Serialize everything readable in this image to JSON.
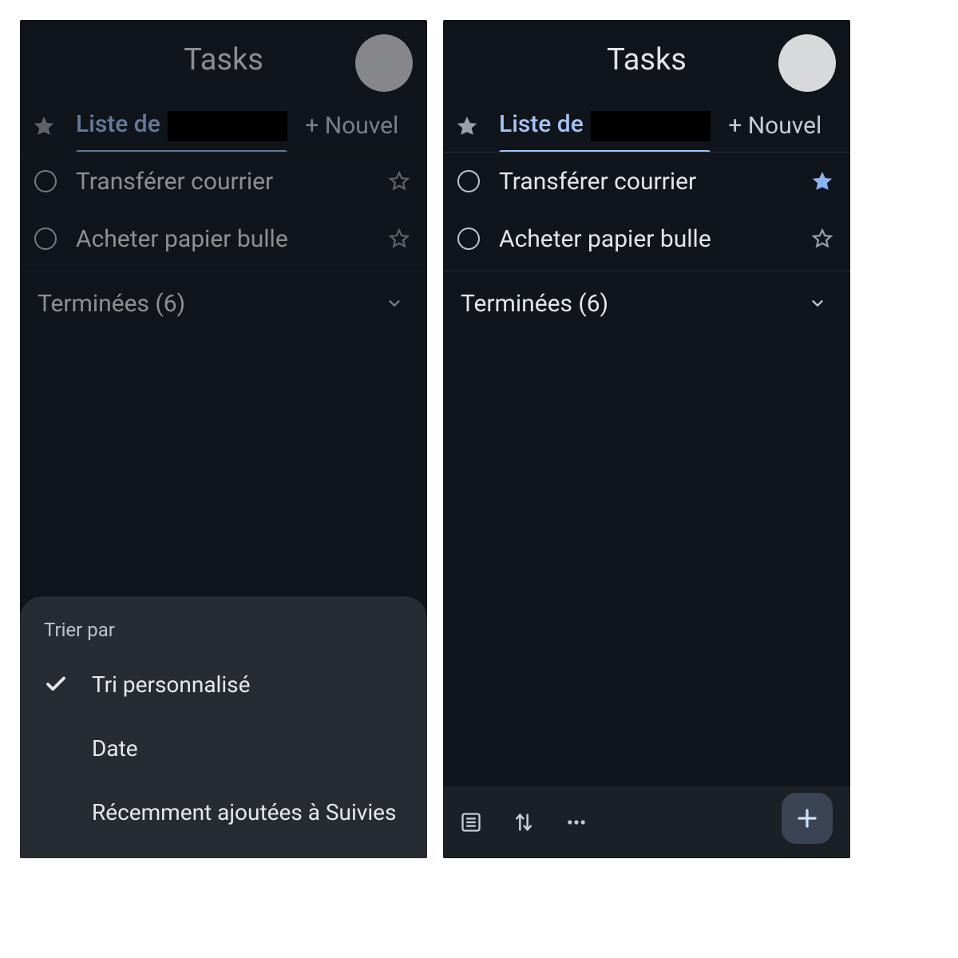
{
  "colors": {
    "accent": "#a5c3f5",
    "text": "#e4e7ea",
    "starFilled": "#8cb3f2",
    "starOutline": "#9aa0a7",
    "circleOutline": "#c0c6cd"
  },
  "left": {
    "header": {
      "title": "Tasks"
    },
    "tabs": {
      "listPrefix": "Liste de ",
      "newList": "+ Nouvel"
    },
    "tasks": [
      {
        "title": "Transférer courrier",
        "starred": false
      },
      {
        "title": "Acheter papier bulle",
        "starred": false
      }
    ],
    "completedLabel": "Terminées (6)",
    "sheet": {
      "title": "Trier par",
      "options": [
        {
          "label": "Tri personnalisé",
          "selected": true
        },
        {
          "label": "Date",
          "selected": false
        },
        {
          "label": "Récemment ajoutées à Suivies",
          "selected": false
        }
      ]
    }
  },
  "right": {
    "header": {
      "title": "Tasks"
    },
    "tabs": {
      "listPrefix": "Liste de ",
      "newList": "+ Nouvel"
    },
    "tasks": [
      {
        "title": "Transférer courrier",
        "starred": true
      },
      {
        "title": "Acheter papier bulle",
        "starred": false
      }
    ],
    "completedLabel": "Terminées (6)",
    "bottomBar": {
      "icons": [
        "list-view-icon",
        "sort-icon",
        "more-icon"
      ],
      "fab": "add"
    }
  }
}
